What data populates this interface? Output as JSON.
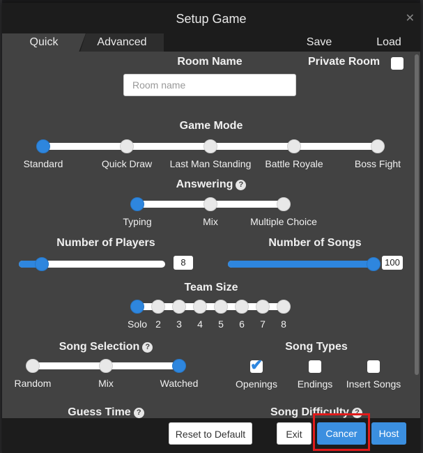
{
  "modal": {
    "title": "Setup Game"
  },
  "tabs": {
    "quick": "Quick",
    "advanced": "Advanced",
    "save": "Save",
    "load": "Load"
  },
  "room": {
    "name_label": "Room Name",
    "name_placeholder": "Room name",
    "private_label": "Private Room",
    "private_checked": false
  },
  "game_mode": {
    "label": "Game Mode",
    "options": [
      "Standard",
      "Quick Draw",
      "Last Man Standing",
      "Battle Royale",
      "Boss Fight"
    ],
    "selected": "Standard"
  },
  "answering": {
    "label": "Answering",
    "options": [
      "Typing",
      "Mix",
      "Multiple Choice"
    ],
    "selected": "Typing"
  },
  "players": {
    "label": "Number of Players",
    "value": "8"
  },
  "songs": {
    "label": "Number of Songs",
    "value": "100"
  },
  "team_size": {
    "label": "Team Size",
    "options": [
      "Solo",
      "2",
      "3",
      "4",
      "5",
      "6",
      "7",
      "8"
    ],
    "selected": "Solo"
  },
  "song_selection": {
    "label": "Song Selection",
    "options": [
      "Random",
      "Mix",
      "Watched"
    ],
    "selected": "Watched"
  },
  "song_types": {
    "label": "Song Types",
    "openings": "Openings",
    "endings": "Endings",
    "inserts": "Insert Songs",
    "openings_checked": true,
    "endings_checked": false,
    "inserts_checked": false
  },
  "guess_time": {
    "label": "Guess Time"
  },
  "song_difficulty": {
    "label": "Song Difficulty"
  },
  "footer": {
    "reset": "Reset to Default",
    "exit": "Exit",
    "cancel": "Cancer",
    "host": "Host"
  },
  "colors": {
    "accent": "#2e86de",
    "panel": "#424242",
    "header": "#1c1c1c",
    "highlight": "#e11b1b"
  },
  "icons": {
    "help": "question-circle-icon",
    "close": "close-icon",
    "check": "checkmark-icon"
  }
}
